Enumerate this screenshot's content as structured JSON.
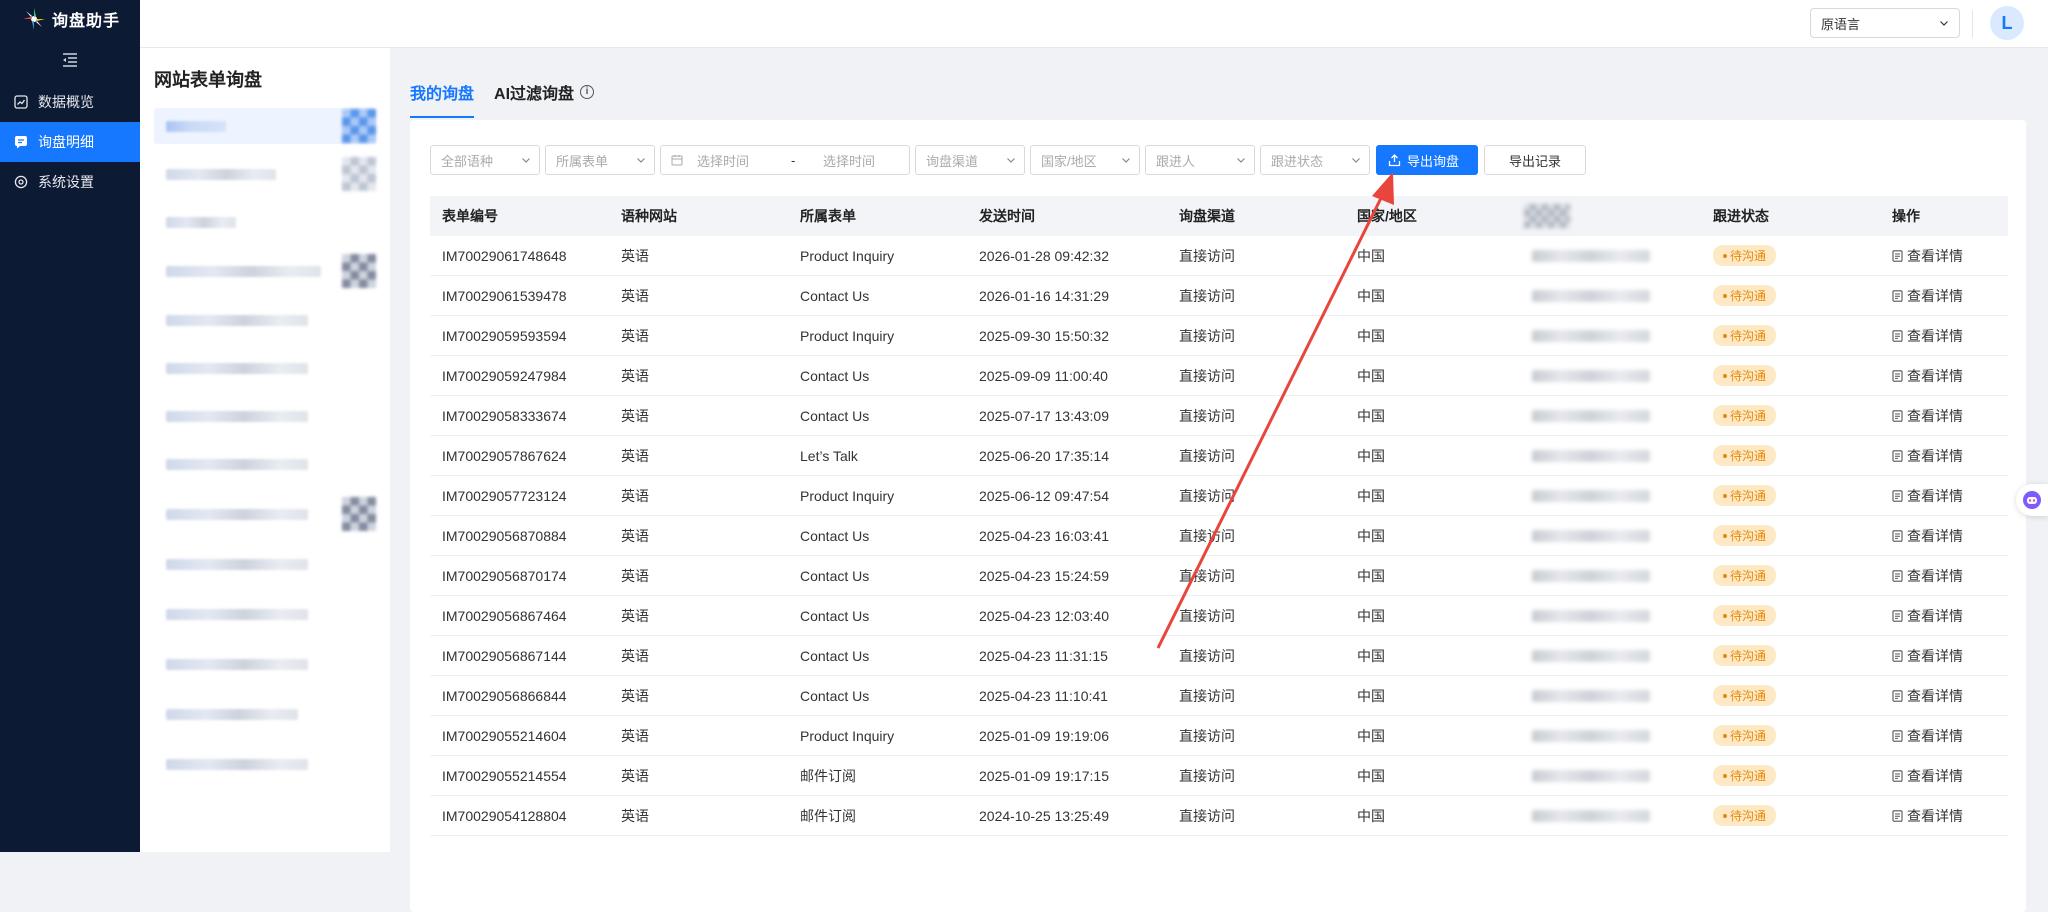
{
  "app": {
    "logo_text": "询盘助手"
  },
  "nav": {
    "items": [
      {
        "label": "数据概览",
        "icon": "chart-icon"
      },
      {
        "label": "询盘明细",
        "icon": "message-icon",
        "active": true
      },
      {
        "label": "系统设置",
        "icon": "settings-icon"
      }
    ]
  },
  "header": {
    "language_selected": "原语言",
    "avatar_letter": "L"
  },
  "sitepanel": {
    "title": "网站表单询盘"
  },
  "tabs": [
    {
      "label": "我的询盘",
      "active": true
    },
    {
      "label": "AI过滤询盘",
      "has_info": true
    }
  ],
  "filters": {
    "language": "全部语种",
    "form": "所属表单",
    "date_start": "选择时间",
    "date_sep": "-",
    "date_end": "选择时间",
    "channel": "询盘渠道",
    "country": "国家/地区",
    "follower": "跟进人",
    "status": "跟进状态",
    "export_button": "导出询盘",
    "export_records_button": "导出记录"
  },
  "table": {
    "columns": [
      "表单编号",
      "语种网站",
      "所属表单",
      "发送时间",
      "询盘渠道",
      "国家/地区",
      "",
      "跟进状态",
      "操作"
    ],
    "rows": [
      [
        "IM70029061748648",
        "英语",
        "Product Inquiry",
        "2026-01-28 09:42:32",
        "直接访问",
        "中国"
      ],
      [
        "IM70029061539478",
        "英语",
        "Contact Us",
        "2026-01-16 14:31:29",
        "直接访问",
        "中国"
      ],
      [
        "IM70029059593594",
        "英语",
        "Product Inquiry",
        "2025-09-30 15:50:32",
        "直接访问",
        "中国"
      ],
      [
        "IM70029059247984",
        "英语",
        "Contact Us",
        "2025-09-09 11:00:40",
        "直接访问",
        "中国"
      ],
      [
        "IM70029058333674",
        "英语",
        "Contact Us",
        "2025-07-17 13:43:09",
        "直接访问",
        "中国"
      ],
      [
        "IM70029057867624",
        "英语",
        "Let’s Talk",
        "2025-06-20 17:35:14",
        "直接访问",
        "中国"
      ],
      [
        "IM70029057723124",
        "英语",
        "Product Inquiry",
        "2025-06-12 09:47:54",
        "直接访问",
        "中国"
      ],
      [
        "IM70029056870884",
        "英语",
        "Contact Us",
        "2025-04-23 16:03:41",
        "直接访问",
        "中国"
      ],
      [
        "IM70029056870174",
        "英语",
        "Contact Us",
        "2025-04-23 15:24:59",
        "直接访问",
        "中国"
      ],
      [
        "IM70029056867464",
        "英语",
        "Contact Us",
        "2025-04-23 12:03:40",
        "直接访问",
        "中国"
      ],
      [
        "IM70029056867144",
        "英语",
        "Contact Us",
        "2025-04-23 11:31:15",
        "直接访问",
        "中国"
      ],
      [
        "IM70029056866844",
        "英语",
        "Contact Us",
        "2025-04-23 11:10:41",
        "直接访问",
        "中国"
      ],
      [
        "IM70029055214604",
        "英语",
        "Product Inquiry",
        "2025-01-09 19:19:06",
        "直接访问",
        "中国"
      ],
      [
        "IM70029055214554",
        "英语",
        "邮件订阅",
        "2025-01-09 19:17:15",
        "直接访问",
        "中国"
      ],
      [
        "IM70029054128804",
        "英语",
        "邮件订阅",
        "2024-10-25 13:25:49",
        "直接访问",
        "中国"
      ]
    ],
    "status_label": "待沟通",
    "action_label": "查看详情"
  },
  "colors": {
    "accent": "#1677ff",
    "nav_bg": "#0d1a33",
    "status": "#e8890c",
    "annotation": "#e8453c"
  }
}
